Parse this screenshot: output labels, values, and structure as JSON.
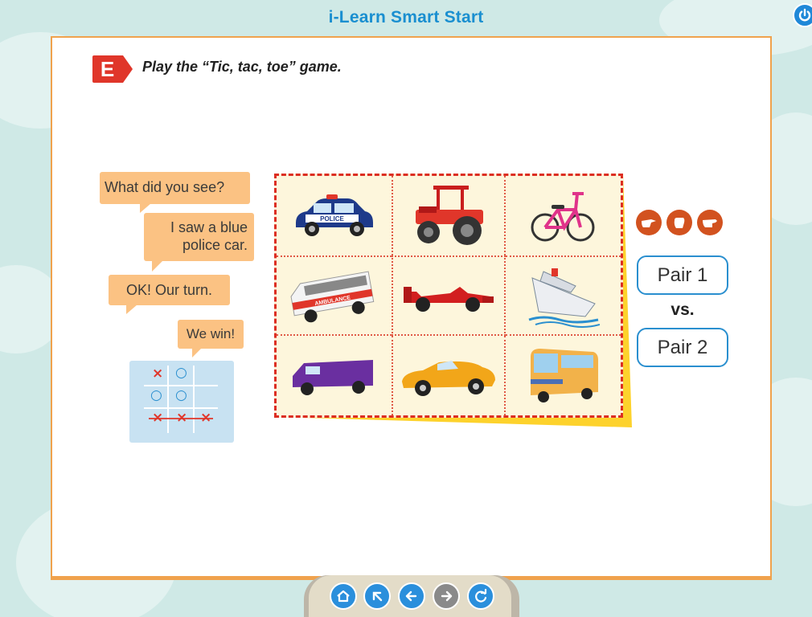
{
  "app": {
    "title": "i-Learn Smart Start"
  },
  "exercise": {
    "badge": "E",
    "instruction": "Play the “Tic, tac, toe” game."
  },
  "dialogue": [
    "What did you see?",
    "I saw a blue police car.",
    "OK! Our turn.",
    "We win!"
  ],
  "example_board": {
    "cells": [
      [
        "×",
        "○",
        ""
      ],
      [
        "○",
        "○",
        ""
      ],
      [
        "×",
        "×",
        "×"
      ]
    ]
  },
  "grid": {
    "pictures": [
      "police-car-icon",
      "tractor-icon",
      "bicycle-icon",
      "ambulance-icon",
      "race-car-icon",
      "ship-icon",
      "van-icon",
      "sports-car-icon",
      "bus-icon"
    ],
    "ambulance_text": "AMBULANCE",
    "police_text": "POLICE"
  },
  "game": {
    "pair1": "Pair 1",
    "vs": "vs.",
    "pair2": "Pair 2"
  },
  "rps_icons": [
    "scissors-hand-icon",
    "rock-hand-icon",
    "paper-hand-icon"
  ],
  "nav": [
    "home-icon",
    "back-arrow-icon",
    "previous-icon",
    "next-icon",
    "refresh-icon"
  ],
  "colors": {
    "accent_orange": "#f0a24d",
    "bubble": "#fbc283",
    "grid_dash": "#dc2e22",
    "pair_border": "#2a8fcf",
    "title_blue": "#1a8fd0"
  }
}
